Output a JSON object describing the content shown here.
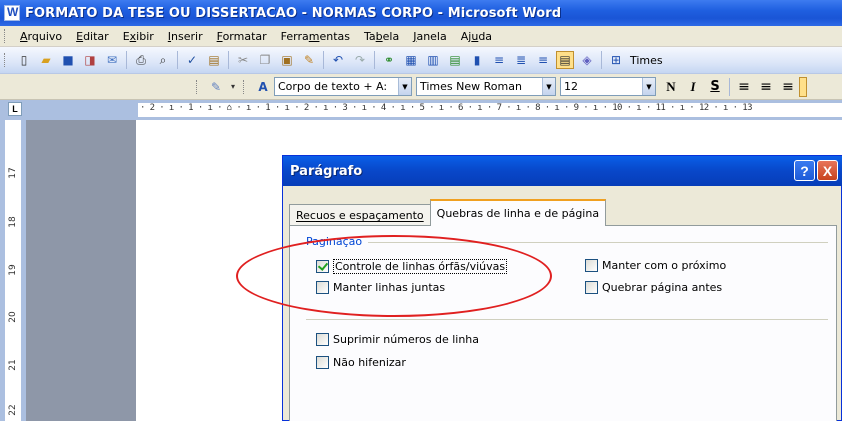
{
  "window": {
    "title": "FORMATO DA TESE OU DISSERTACAO - NORMAS CORPO - Microsoft Word"
  },
  "menu": [
    {
      "label": "Arquivo",
      "u": "A",
      "rest": "rquivo"
    },
    {
      "label": "Editar",
      "u": "E",
      "rest": "ditar"
    },
    {
      "label": "Exibir",
      "pre": "E",
      "u": "x",
      "rest": "ibir"
    },
    {
      "label": "Inserir",
      "u": "I",
      "rest": "nserir"
    },
    {
      "label": "Formatar",
      "u": "F",
      "rest": "ormatar"
    },
    {
      "label": "Ferramentas",
      "pre": "Ferra",
      "u": "m",
      "rest": "entas"
    },
    {
      "label": "Tabela",
      "pre": "Ta",
      "u": "b",
      "rest": "ela"
    },
    {
      "label": "Janela",
      "u": "J",
      "rest": "anela"
    },
    {
      "label": "Ajuda",
      "pre": "Aj",
      "u": "u",
      "rest": "da"
    }
  ],
  "toolbar": {
    "font_partial": "Times",
    "style_value": "Corpo de texto + A:",
    "font_value": "Times New Roman",
    "size_value": "12",
    "bold": "N",
    "italic": "I",
    "underline": "S"
  },
  "ruler": {
    "text": "· 2 · ı · 1 · ı · ⌂ · ı · 1 · ı · 2 · ı · 3 · ı · 4 · ı · 5 · ı · 6 · ı · 7 · ı · 8 · ı · 9 · ı · 10 · ı · 11 · ı · 12 · ı · 13",
    "corner": "L",
    "vertical": [
      "17",
      "18",
      "19",
      "20",
      "21",
      "22"
    ]
  },
  "dialog": {
    "title": "Parágrafo",
    "help": "?",
    "close": "X",
    "tabs": [
      {
        "label": "Recuos e espaçamento",
        "selected": false
      },
      {
        "label": "Quebras de linha e de página",
        "selected": true
      }
    ],
    "group_label": "Paginação",
    "checkboxes": [
      {
        "label": "Controle de linhas órfãs/viúvas",
        "checked": true
      },
      {
        "label": "Manter com o próximo",
        "checked": false
      },
      {
        "label": "Manter linhas juntas",
        "checked": false
      },
      {
        "label": "Quebrar página antes",
        "checked": false
      },
      {
        "label": "Suprimir números de linha",
        "checked": false
      },
      {
        "label": "Não hifenizar",
        "checked": false
      }
    ]
  },
  "colors": {
    "titlebar": "#1f5fe0",
    "dialog_title": "#0847c9",
    "annotation": "#e02020",
    "group_label": "#0046d5"
  }
}
